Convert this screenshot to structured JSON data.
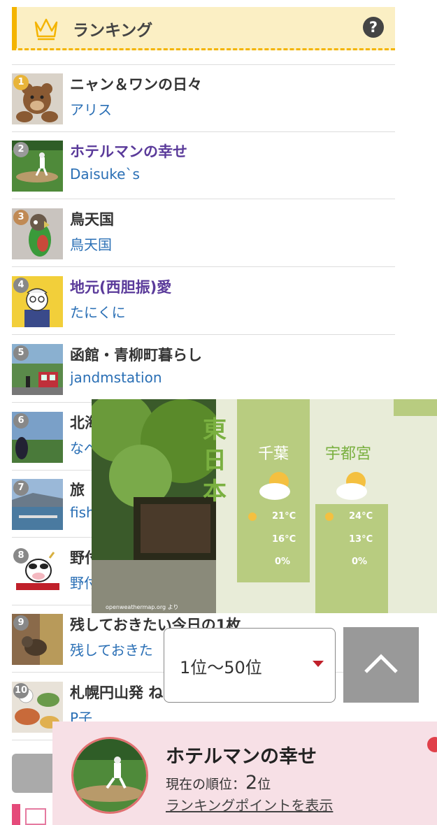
{
  "header": {
    "title": "ランキング",
    "help_label": "?"
  },
  "ranking": [
    {
      "rank": "1",
      "title": "ニャン＆ワンの日々",
      "author": "アリス",
      "visited": false,
      "icon": "teddy-bear-photo"
    },
    {
      "rank": "2",
      "title": "ホテルマンの幸せ",
      "author": "Daisuke`s",
      "visited": true,
      "icon": "baseball-pitcher-photo"
    },
    {
      "rank": "3",
      "title": "鳥天国",
      "author": "鳥天国",
      "visited": false,
      "icon": "parrot-photo"
    },
    {
      "rank": "4",
      "title": "地元(西胆振)愛",
      "author": "たにくに",
      "visited": true,
      "icon": "cartoon-man-illustration"
    },
    {
      "rank": "5",
      "title": "函館・青柳町暮らし",
      "author": "jandmstation",
      "visited": false,
      "icon": "streetcar-photo"
    },
    {
      "rank": "6",
      "title": "北海",
      "author": "なべ",
      "visited": false,
      "icon": "field-photo"
    },
    {
      "rank": "7",
      "title": "旅",
      "author": "fish",
      "visited": false,
      "icon": "harbor-photo"
    },
    {
      "rank": "8",
      "title": "野付",
      "author": "野付",
      "visited": false,
      "icon": "cow-illustration"
    },
    {
      "rank": "9",
      "title": "残しておきたい今日の1枚",
      "author": "残しておきた",
      "visited": false,
      "icon": "squirrel-photo"
    },
    {
      "rank": "10",
      "title": "札幌円山発 ね",
      "author": "P子",
      "visited": false,
      "icon": "food-photo"
    }
  ],
  "video_ad": {
    "region": "東日本",
    "credit": "openweathermap.org より",
    "cities": [
      {
        "name": "千葉",
        "high": "21°C",
        "low": "16°C",
        "rain": "0%"
      },
      {
        "name": "宇都宮",
        "high": "24°C",
        "low": "13°C",
        "rain": "0%"
      }
    ]
  },
  "range_select": {
    "value": "1位〜50位"
  },
  "current_blog": {
    "title": "ホテルマンの幸せ",
    "rank_prefix": "現在の順位：",
    "rank_value": "2",
    "rank_suffix": "位",
    "link_label": "ランキングポイントを表示"
  },
  "colors": {
    "accent": "#f4b400",
    "link": "#2a6fb5",
    "visited": "#5a3a9a",
    "banner_bg": "#f7e0e6"
  }
}
